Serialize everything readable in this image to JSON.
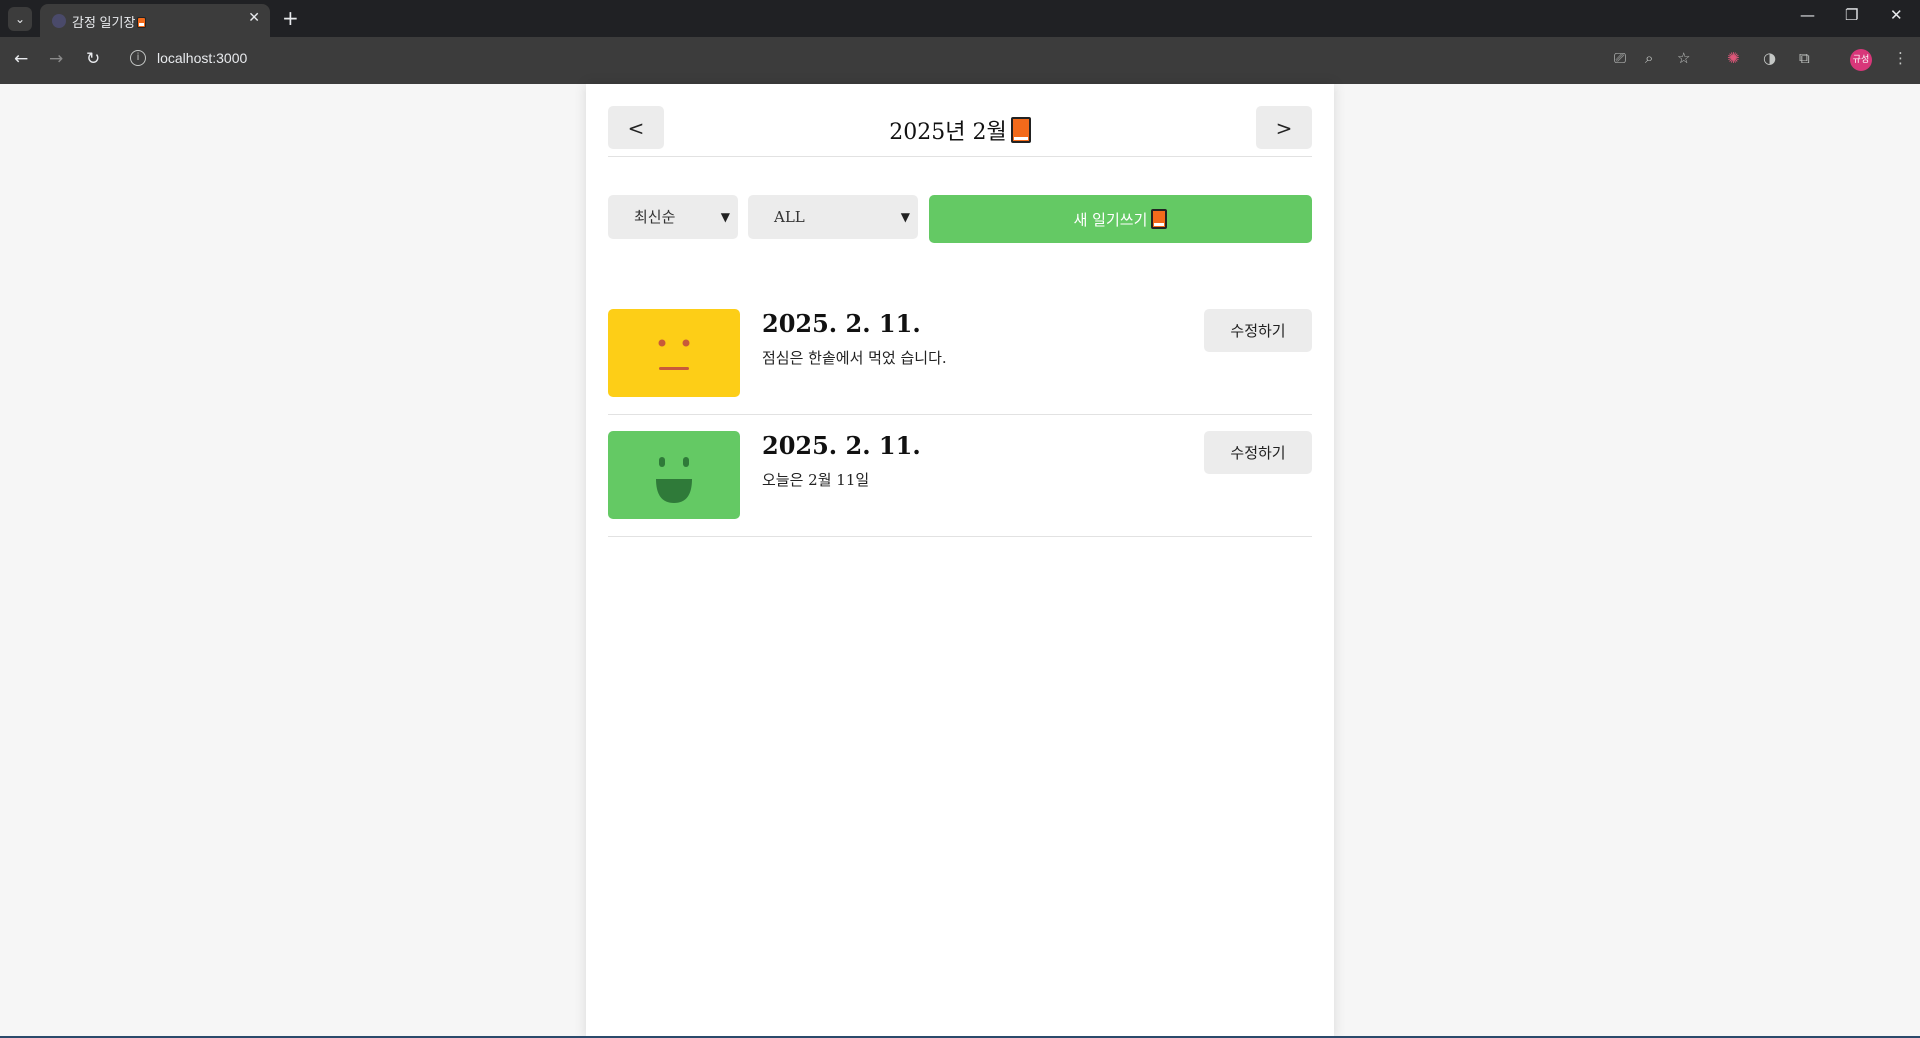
{
  "browser": {
    "tab_title": "감정 일기장",
    "new_tab": "+",
    "tab_close": "✕",
    "url": "localhost:3000",
    "profile_initials": "규성"
  },
  "header": {
    "title": "2025년 2월",
    "prev_label": "<",
    "next_label": ">"
  },
  "menu": {
    "sort_selected": "최신순",
    "emotion_filter_selected": "ALL",
    "new_diary_label": "새 일기쓰기"
  },
  "colors": {
    "accent_green": "#64c964",
    "emotion_neutral": "#fdce17",
    "emotion_good": "#64c964",
    "book_orange": "#f26a1b"
  },
  "diaries": [
    {
      "date": "2025. 2. 11.",
      "content": "점심은 한솥에서 먹었 습니다.",
      "emotion": "neutral",
      "edit_label": "수정하기"
    },
    {
      "date": "2025. 2. 11.",
      "content": "오늘은 2월 11일",
      "emotion": "good",
      "edit_label": "수정하기"
    }
  ]
}
